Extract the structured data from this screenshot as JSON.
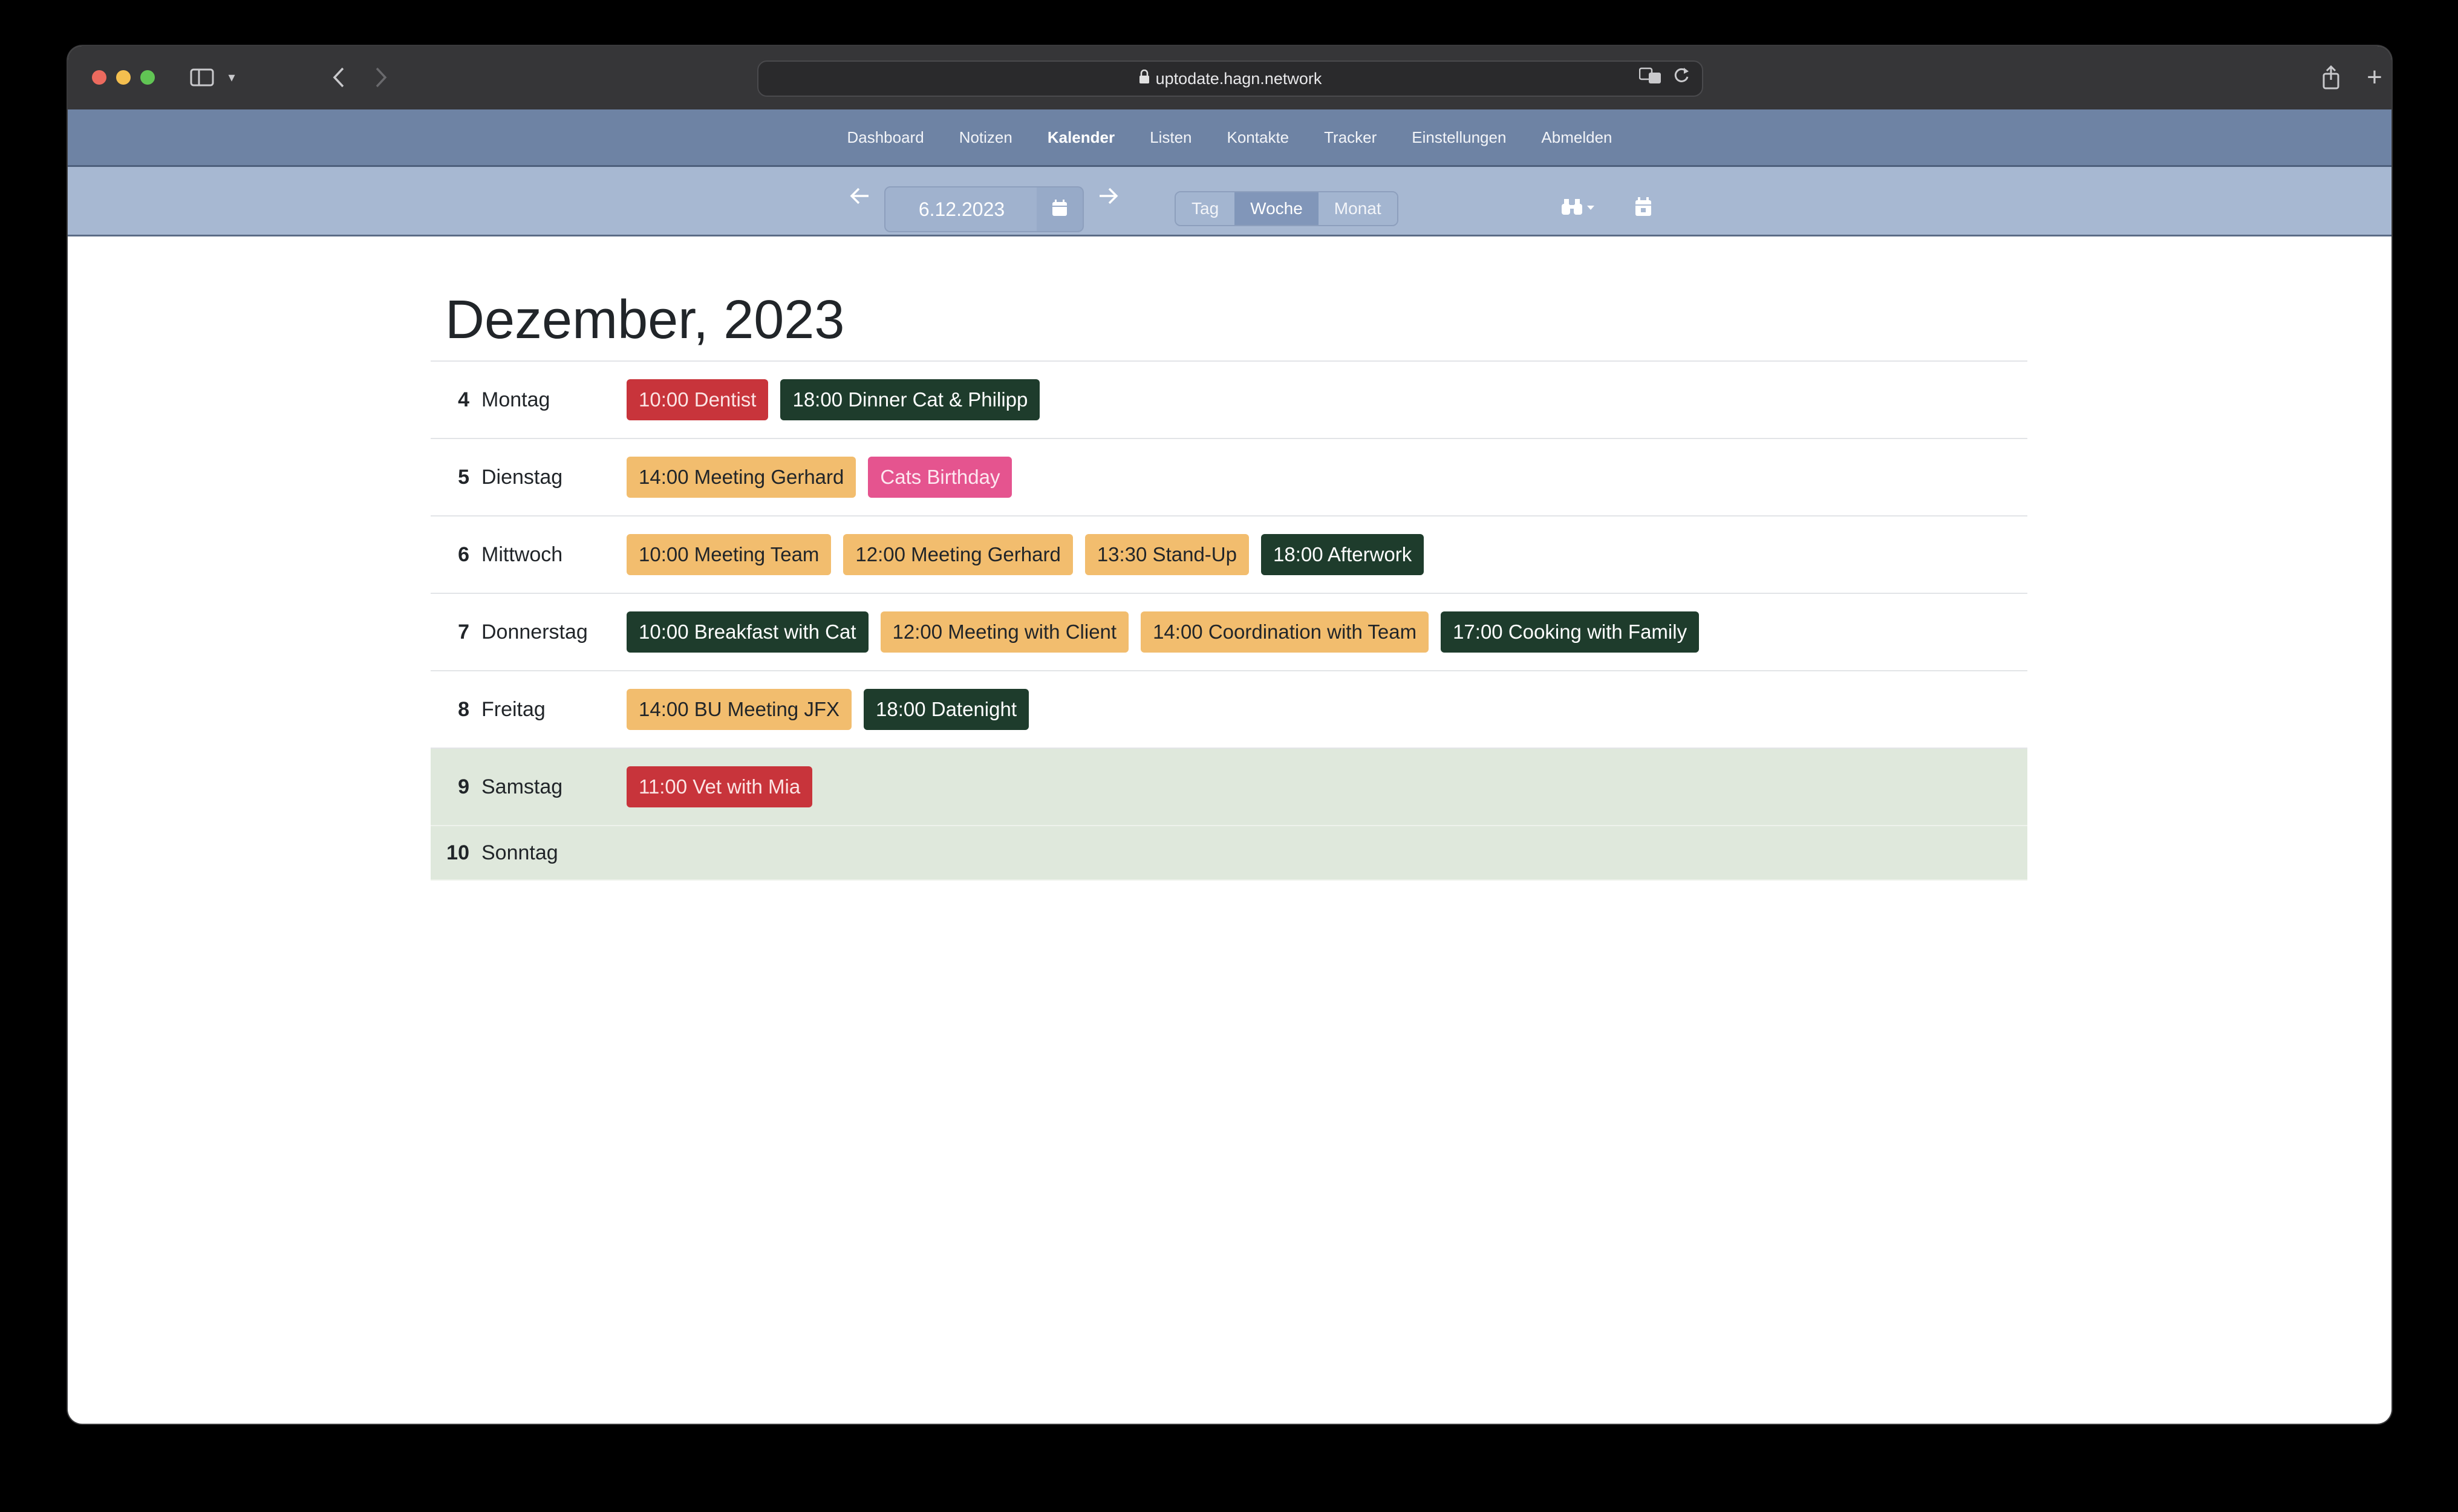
{
  "browser": {
    "url": "uptodate.hagn.network"
  },
  "nav": {
    "items": [
      {
        "label": "Dashboard",
        "active": false
      },
      {
        "label": "Notizen",
        "active": false
      },
      {
        "label": "Kalender",
        "active": true
      },
      {
        "label": "Listen",
        "active": false
      },
      {
        "label": "Kontakte",
        "active": false
      },
      {
        "label": "Tracker",
        "active": false
      },
      {
        "label": "Einstellungen",
        "active": false
      },
      {
        "label": "Abmelden",
        "active": false
      }
    ]
  },
  "toolbar": {
    "date_value": "6.12.2023",
    "view_options": [
      {
        "label": "Tag",
        "selected": false
      },
      {
        "label": "Woche",
        "selected": true
      },
      {
        "label": "Monat",
        "selected": false
      }
    ]
  },
  "calendar": {
    "title": "Dezember, 2023",
    "days": [
      {
        "num": "4",
        "name": "Montag",
        "weekend": false,
        "events": [
          {
            "text": "10:00 Dentist",
            "style": "red"
          },
          {
            "text": "18:00 Dinner Cat & Philipp",
            "style": "dark"
          }
        ]
      },
      {
        "num": "5",
        "name": "Dienstag",
        "weekend": false,
        "events": [
          {
            "text": "14:00 Meeting Gerhard",
            "style": "orange"
          },
          {
            "text": "Cats Birthday",
            "style": "pink"
          }
        ]
      },
      {
        "num": "6",
        "name": "Mittwoch",
        "weekend": false,
        "events": [
          {
            "text": "10:00 Meeting Team",
            "style": "orange"
          },
          {
            "text": "12:00 Meeting Gerhard",
            "style": "orange"
          },
          {
            "text": "13:30 Stand-Up",
            "style": "orange"
          },
          {
            "text": "18:00 Afterwork",
            "style": "dark"
          }
        ]
      },
      {
        "num": "7",
        "name": "Donnerstag",
        "weekend": false,
        "events": [
          {
            "text": "10:00 Breakfast with Cat",
            "style": "dark"
          },
          {
            "text": "12:00 Meeting with Client",
            "style": "orange"
          },
          {
            "text": "14:00 Coordination with Team",
            "style": "orange"
          },
          {
            "text": "17:00 Cooking with Family",
            "style": "dark"
          }
        ]
      },
      {
        "num": "8",
        "name": "Freitag",
        "weekend": false,
        "events": [
          {
            "text": "14:00 BU Meeting JFX",
            "style": "orange"
          },
          {
            "text": "18:00 Datenight",
            "style": "dark"
          }
        ]
      },
      {
        "num": "9",
        "name": "Samstag",
        "weekend": true,
        "events": [
          {
            "text": "11:00 Vet with Mia",
            "style": "red"
          }
        ]
      },
      {
        "num": "10",
        "name": "Sonntag",
        "weekend": true,
        "events": []
      }
    ]
  }
}
